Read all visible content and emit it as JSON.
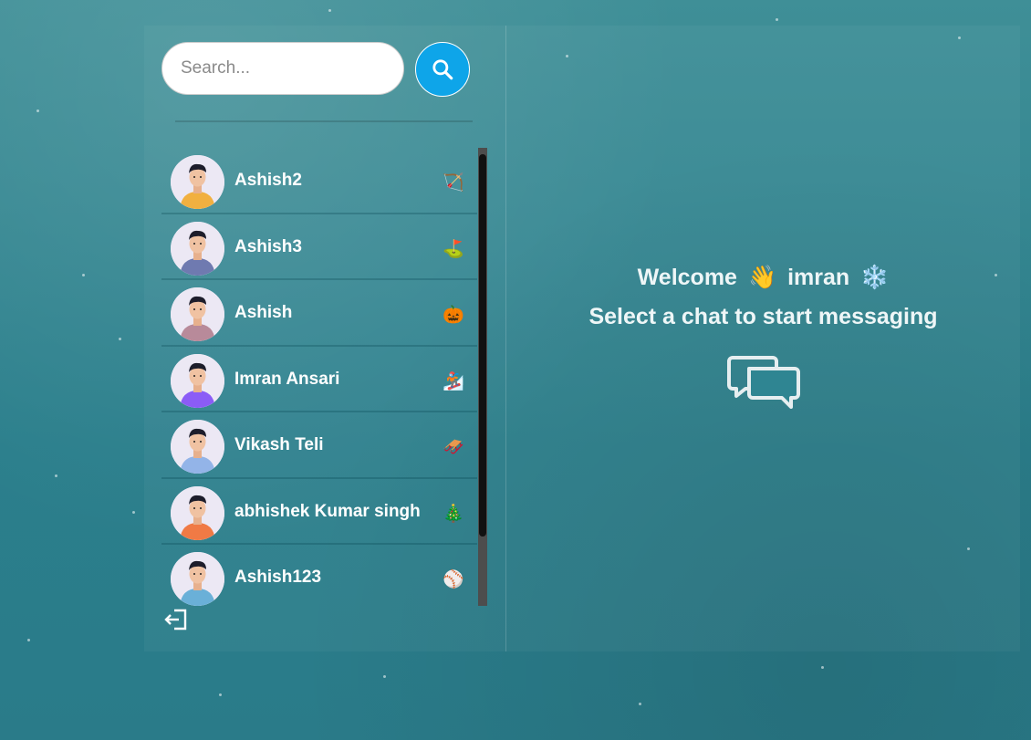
{
  "search": {
    "placeholder": "Search..."
  },
  "contacts": [
    {
      "name": "Ashish2",
      "emoji": "🏹",
      "shirt": "#f1b040"
    },
    {
      "name": "Ashish3",
      "emoji": "⛳",
      "shirt": "#6f7ab0"
    },
    {
      "name": "Ashish",
      "emoji": "🎃",
      "shirt": "#b88a9a"
    },
    {
      "name": "Imran Ansari",
      "emoji": "🏂",
      "shirt": "#8b5cf6"
    },
    {
      "name": "Vikash Teli",
      "emoji": "🛷",
      "shirt": "#93b4e8"
    },
    {
      "name": "abhishek Kumar singh",
      "emoji": "🎄",
      "shirt": "#f07a45"
    },
    {
      "name": "Ashish123",
      "emoji": "⚾",
      "shirt": "#6ab0d8"
    }
  ],
  "welcome": {
    "greeting": "Welcome",
    "wave": "👋",
    "user": "imran",
    "snow": "❄️",
    "subtitle": "Select a chat to start messaging"
  },
  "icons": {
    "search": "search-icon",
    "logout": "logout-icon",
    "chat": "chat-bubbles-icon"
  },
  "colors": {
    "accent": "#0ea5e9"
  }
}
